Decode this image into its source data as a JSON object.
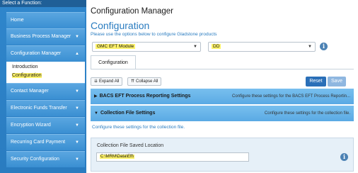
{
  "sidebar": {
    "header": "Select a Function:",
    "items": [
      {
        "label": "Home",
        "has_chevron": false
      },
      {
        "label": "Business Process Manager",
        "has_chevron": true
      },
      {
        "label": "Configuration Manager",
        "has_chevron": true,
        "expanded": true
      },
      {
        "label": "Contact Manager",
        "has_chevron": true
      },
      {
        "label": "Electronic Funds Transfer",
        "has_chevron": true
      },
      {
        "label": "Encryption Wizard",
        "has_chevron": true
      },
      {
        "label": "Recurring Card Payment",
        "has_chevron": true
      },
      {
        "label": "Security Configuration",
        "has_chevron": true
      }
    ],
    "sub_items": [
      {
        "label": "Introduction",
        "active": false
      },
      {
        "label": "Configuration",
        "active": true
      }
    ]
  },
  "main": {
    "app_title": "Configuration Manager",
    "section_title": "Configuration",
    "subtitle": "Please use the options below to configure Gladstone products",
    "module_select": {
      "value": "GMC EFT Module"
    },
    "type_select": {
      "value": "DD"
    },
    "tab": "Configuration",
    "toolbar": {
      "expand_all": "Expand All",
      "collapse_all": "Collapse All"
    },
    "actions": {
      "reset": "Reset",
      "save": "Save"
    },
    "panels": [
      {
        "title": "BACS EFT Process Reporting Settings",
        "description": "Configure these settings for the BACS EFT Process Reportin...",
        "expanded": false
      },
      {
        "title": "Collection File Settings",
        "description": "Configure these settings for the collection file.",
        "expanded": true
      }
    ],
    "panel_body_text": "Configure these settings for the collection file.",
    "field": {
      "label": "Collection File Saved Location",
      "value": "C:\\MRM\\Data\\Eft\\"
    }
  },
  "colors": {
    "sidebar_blue": "#2a7cc0",
    "accent_blue": "#2a7cc0",
    "highlight_yellow": "#fff36a",
    "panel_blue": "#5aaae4",
    "reset_button": "#2a6fb8",
    "save_button": "#8fb7e0"
  },
  "icons": {
    "chevron": "chevron-down-icon",
    "chevron_up": "chevron-up-icon",
    "info": "info-icon",
    "expand": "expand-icon",
    "collapse": "collapse-icon",
    "panel_collapsed": "chevron-right-icon",
    "panel_expanded": "chevron-down-icon"
  }
}
